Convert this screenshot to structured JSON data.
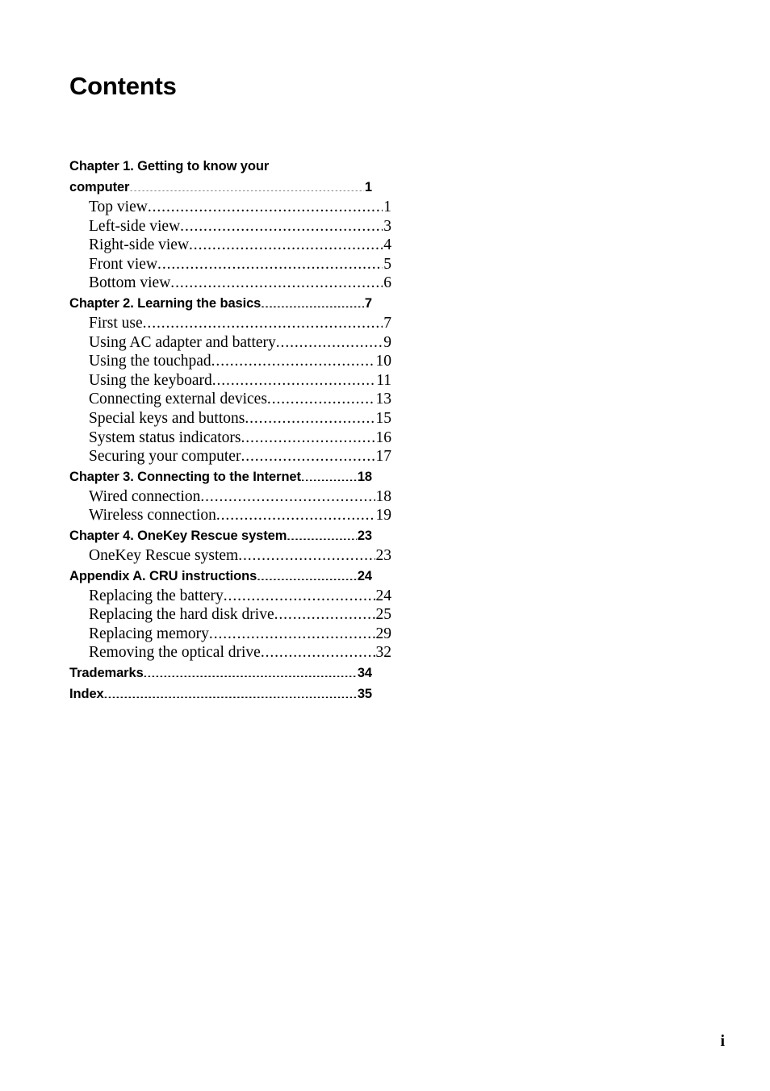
{
  "page": {
    "title": "Contents",
    "folio": "i",
    "background_color": "#ffffff",
    "text_color": "#000000"
  },
  "toc": {
    "entries": [
      {
        "label": "Chapter 1. Getting to know your",
        "page": "",
        "level": "chapter",
        "wrap_head": true
      },
      {
        "label": "computer",
        "page": "1",
        "level": "chapter",
        "wrap_head": false
      },
      {
        "label": "Top view",
        "page": "1",
        "level": "sub",
        "wrap_head": false
      },
      {
        "label": "Left-side view",
        "page": "3",
        "level": "sub",
        "wrap_head": false
      },
      {
        "label": "Right-side view",
        "page": "4",
        "level": "sub",
        "wrap_head": false
      },
      {
        "label": "Front view",
        "page": "5",
        "level": "sub",
        "wrap_head": false
      },
      {
        "label": "Bottom view",
        "page": "6",
        "level": "sub",
        "wrap_head": false
      },
      {
        "label": "Chapter 2. Learning the basics",
        "page": "7",
        "level": "chapter",
        "wrap_head": false
      },
      {
        "label": "First use",
        "page": "7",
        "level": "sub",
        "wrap_head": false
      },
      {
        "label": "Using AC adapter and battery",
        "page": "9",
        "level": "sub",
        "wrap_head": false
      },
      {
        "label": "Using the touchpad",
        "page": "10",
        "level": "sub",
        "wrap_head": false
      },
      {
        "label": "Using the keyboard",
        "page": "11",
        "level": "sub",
        "wrap_head": false
      },
      {
        "label": "Connecting external devices",
        "page": "13",
        "level": "sub",
        "wrap_head": false
      },
      {
        "label": "Special keys and buttons",
        "page": "15",
        "level": "sub",
        "wrap_head": false
      },
      {
        "label": "System status indicators",
        "page": "16",
        "level": "sub",
        "wrap_head": false
      },
      {
        "label": "Securing your computer",
        "page": "17",
        "level": "sub",
        "wrap_head": false
      },
      {
        "label": "Chapter 3. Connecting to the Internet",
        "page": "18",
        "level": "chapter",
        "wrap_head": false
      },
      {
        "label": "Wired connection",
        "page": "18",
        "level": "sub",
        "wrap_head": false
      },
      {
        "label": "Wireless connection",
        "page": "19",
        "level": "sub",
        "wrap_head": false
      },
      {
        "label": "Chapter 4. OneKey Rescue system",
        "page": "23",
        "level": "chapter",
        "wrap_head": false
      },
      {
        "label": "OneKey Rescue system",
        "page": "23",
        "level": "sub",
        "wrap_head": false
      },
      {
        "label": "Appendix A. CRU instructions",
        "page": "24",
        "level": "chapter",
        "wrap_head": false
      },
      {
        "label": "Replacing the battery",
        "page": "24",
        "level": "sub",
        "wrap_head": false
      },
      {
        "label": "Replacing the hard disk drive",
        "page": "25",
        "level": "sub",
        "wrap_head": false
      },
      {
        "label": "Replacing memory",
        "page": "29",
        "level": "sub",
        "wrap_head": false
      },
      {
        "label": "Removing the optical drive",
        "page": "32",
        "level": "sub",
        "wrap_head": false
      },
      {
        "label": "Trademarks",
        "page": "34",
        "level": "chapter",
        "wrap_head": false
      },
      {
        "label": "Index",
        "page": "35",
        "level": "chapter",
        "wrap_head": false
      }
    ]
  }
}
